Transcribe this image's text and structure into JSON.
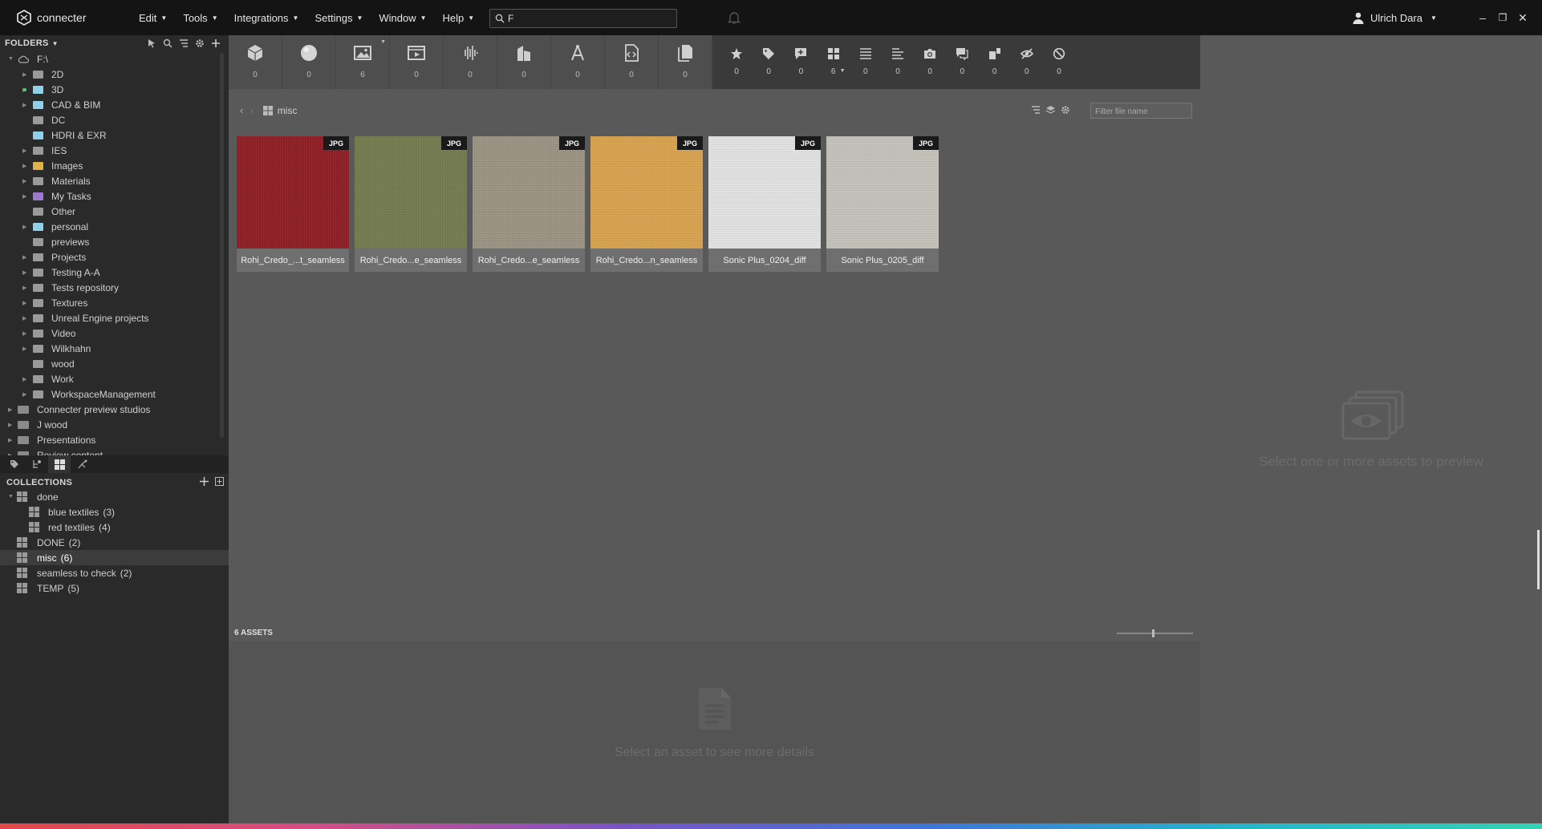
{
  "app": {
    "name": "connecter"
  },
  "menu": [
    {
      "label": "Edit"
    },
    {
      "label": "Tools"
    },
    {
      "label": "Integrations"
    },
    {
      "label": "Settings"
    },
    {
      "label": "Window"
    },
    {
      "label": "Help"
    }
  ],
  "search": {
    "value": "F"
  },
  "user": {
    "name": "Ulrich Dara"
  },
  "window_controls": {
    "minimize": "–",
    "restore": "❐",
    "close": "✕"
  },
  "folders": {
    "title": "FOLDERS",
    "root": "F:\\",
    "items": [
      {
        "label": "2D",
        "color": "#9a9a9a",
        "arrow": true
      },
      {
        "label": "3D",
        "color": "#8fd1e8",
        "arrow": true,
        "dot": true
      },
      {
        "label": "CAD & BIM",
        "color": "#8fd1e8",
        "arrow": true
      },
      {
        "label": "DC",
        "color": "#9a9a9a",
        "arrow": false
      },
      {
        "label": "HDRI & EXR",
        "color": "#8fd1e8",
        "arrow": false
      },
      {
        "label": "IES",
        "color": "#9a9a9a",
        "arrow": true
      },
      {
        "label": "Images",
        "color": "#e0b24a",
        "arrow": true
      },
      {
        "label": "Materials",
        "color": "#9a9a9a",
        "arrow": true
      },
      {
        "label": "My Tasks",
        "color": "#9c7ad0",
        "arrow": true
      },
      {
        "label": "Other",
        "color": "#9a9a9a",
        "arrow": false
      },
      {
        "label": "personal",
        "color": "#8fd1e8",
        "arrow": true
      },
      {
        "label": "previews",
        "color": "#9a9a9a",
        "arrow": false
      },
      {
        "label": "Projects",
        "color": "#9a9a9a",
        "arrow": true
      },
      {
        "label": "Testing A-A",
        "color": "#9a9a9a",
        "arrow": true
      },
      {
        "label": "Tests repository",
        "color": "#9a9a9a",
        "arrow": true
      },
      {
        "label": "Textures",
        "color": "#9a9a9a",
        "arrow": true
      },
      {
        "label": "Unreal Engine projects",
        "color": "#9a9a9a",
        "arrow": true
      },
      {
        "label": "Video",
        "color": "#9a9a9a",
        "arrow": true
      },
      {
        "label": "Wilkhahn",
        "color": "#9a9a9a",
        "arrow": true
      },
      {
        "label": "wood",
        "color": "#9a9a9a",
        "arrow": false
      },
      {
        "label": "Work",
        "color": "#9a9a9a",
        "arrow": true
      },
      {
        "label": "WorkspaceManagement",
        "color": "#9a9a9a",
        "arrow": true
      }
    ],
    "workspaces": [
      "Connecter preview studios",
      "J wood",
      "Presentations",
      "Review content"
    ]
  },
  "collections": {
    "title": "COLLECTIONS",
    "items": [
      {
        "label": "done",
        "count": "",
        "level": 0,
        "group": true
      },
      {
        "label": "blue textiles",
        "count": "(3)",
        "level": 1
      },
      {
        "label": "red textiles",
        "count": "(4)",
        "level": 1
      },
      {
        "label": "DONE",
        "count": "(2)",
        "level": 0
      },
      {
        "label": "misc",
        "count": "(6)",
        "level": 0,
        "selected": true
      },
      {
        "label": "seamless to check",
        "count": "(2)",
        "level": 0
      },
      {
        "label": "TEMP",
        "count": "(5)",
        "level": 0
      }
    ]
  },
  "type_filters": [
    {
      "icon": "3d-model-icon",
      "count": "0"
    },
    {
      "icon": "material-sphere-icon",
      "count": "0"
    },
    {
      "icon": "image-icon",
      "count": "6"
    },
    {
      "icon": "video-icon",
      "count": "0"
    },
    {
      "icon": "audio-icon",
      "count": "0"
    },
    {
      "icon": "building-icon",
      "count": "0"
    },
    {
      "icon": "vector-icon",
      "count": "0"
    },
    {
      "icon": "code-icon",
      "count": "0"
    },
    {
      "icon": "document-icon",
      "count": "0"
    }
  ],
  "attribute_filters": [
    {
      "icon": "star-icon",
      "count": "0"
    },
    {
      "icon": "tag-icon",
      "count": "0"
    },
    {
      "icon": "comment-add-icon",
      "count": "0"
    },
    {
      "icon": "collection-icon",
      "count": "6"
    },
    {
      "icon": "list-icon",
      "count": "0"
    },
    {
      "icon": "align-icon",
      "count": "0"
    },
    {
      "icon": "camera-icon",
      "count": "0"
    },
    {
      "icon": "chat-icon",
      "count": "0"
    },
    {
      "icon": "version-icon",
      "count": "0"
    },
    {
      "icon": "hidden-icon",
      "count": "0"
    },
    {
      "icon": "blocked-icon",
      "count": "0"
    }
  ],
  "breadcrumb": {
    "label": "misc"
  },
  "filter": {
    "placeholder": "Filter file name"
  },
  "assets": [
    {
      "name": "Rohi_Credo_...t_seamless",
      "type": "JPG",
      "color": "#8e1f26"
    },
    {
      "name": "Rohi_Credo...e_seamless",
      "type": "JPG",
      "color": "#747b4e"
    },
    {
      "name": "Rohi_Credo...e_seamless",
      "type": "JPG",
      "color": "#9b9283"
    },
    {
      "name": "Rohi_Credo...n_seamless",
      "type": "JPG",
      "color": "#d7a24f"
    },
    {
      "name": "Sonic Plus_0204_diff",
      "type": "JPG",
      "color": "#e1e1e1"
    },
    {
      "name": "Sonic Plus_0205_diff",
      "type": "JPG",
      "color": "#c4c1bb"
    }
  ],
  "assets_count": "6 ASSETS",
  "details": {
    "empty_message": "Select an asset to see more details"
  },
  "preview": {
    "empty_message": "Select one or more assets to preview"
  }
}
